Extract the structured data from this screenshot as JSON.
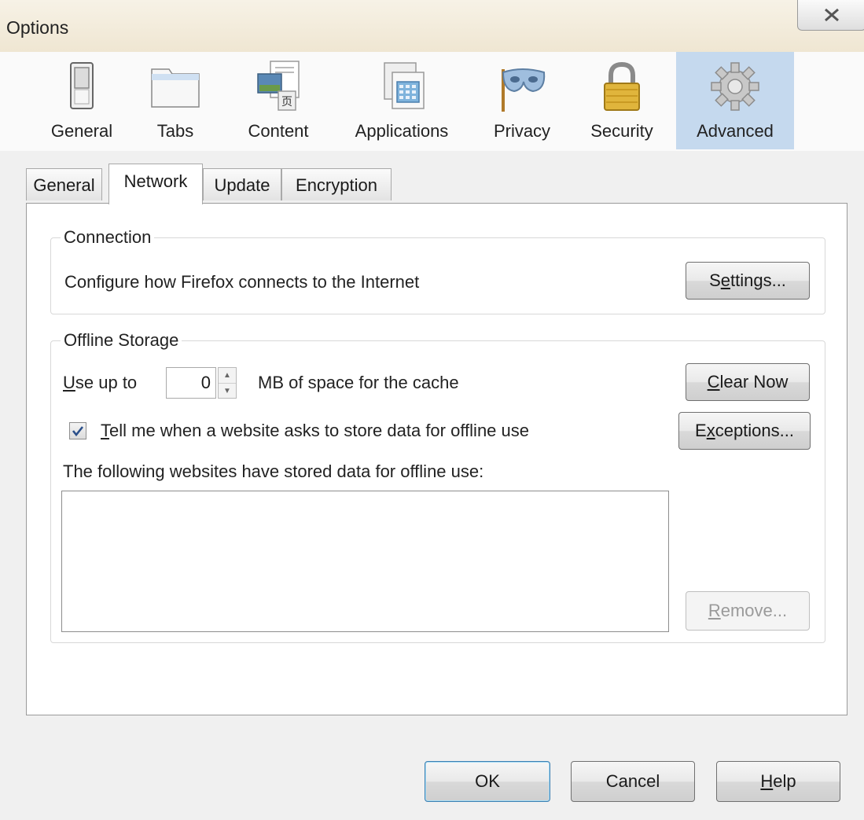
{
  "window": {
    "title": "Options"
  },
  "toolbar": {
    "items": [
      {
        "label": "General",
        "icon": "general-icon"
      },
      {
        "label": "Tabs",
        "icon": "tabs-icon"
      },
      {
        "label": "Content",
        "icon": "content-icon"
      },
      {
        "label": "Applications",
        "icon": "applications-icon"
      },
      {
        "label": "Privacy",
        "icon": "privacy-icon"
      },
      {
        "label": "Security",
        "icon": "security-icon"
      },
      {
        "label": "Advanced",
        "icon": "advanced-icon",
        "selected": true
      }
    ]
  },
  "tabs": [
    {
      "label": "General"
    },
    {
      "label": "Network",
      "active": true
    },
    {
      "label": "Update"
    },
    {
      "label": "Encryption"
    }
  ],
  "connection": {
    "legend": "Connection",
    "description": "Configure how Firefox connects to the Internet",
    "settings_button": {
      "mnemonic_pre": "S",
      "mnemonic": "e",
      "mnemonic_post": "ttings..."
    }
  },
  "offline": {
    "legend": "Offline Storage",
    "use_up_to": {
      "mnemonic": "U",
      "rest": "se up to"
    },
    "cache_value": "0",
    "cache_suffix": "MB of space for the cache",
    "clear_now_button": {
      "mnemonic": "C",
      "rest": "lear Now"
    },
    "tell_me": {
      "checked": true,
      "mnemonic": "T",
      "rest": "ell me when a website asks to store data for offline use"
    },
    "exceptions_button": {
      "pre": "E",
      "mnemonic": "x",
      "rest": "ceptions..."
    },
    "stored_label": "The following websites have stored data for offline use:",
    "stored_sites": [],
    "remove_button": {
      "mnemonic": "R",
      "rest": "emove...",
      "disabled": true
    }
  },
  "footer": {
    "ok": "OK",
    "cancel": "Cancel",
    "help": {
      "mnemonic": "H",
      "rest": "elp"
    }
  },
  "colors": {
    "selected_toolbar_bg": "#c5d9ee",
    "default_button_border": "#3c7fb1",
    "checkbox_check": "#2b4f8a"
  }
}
